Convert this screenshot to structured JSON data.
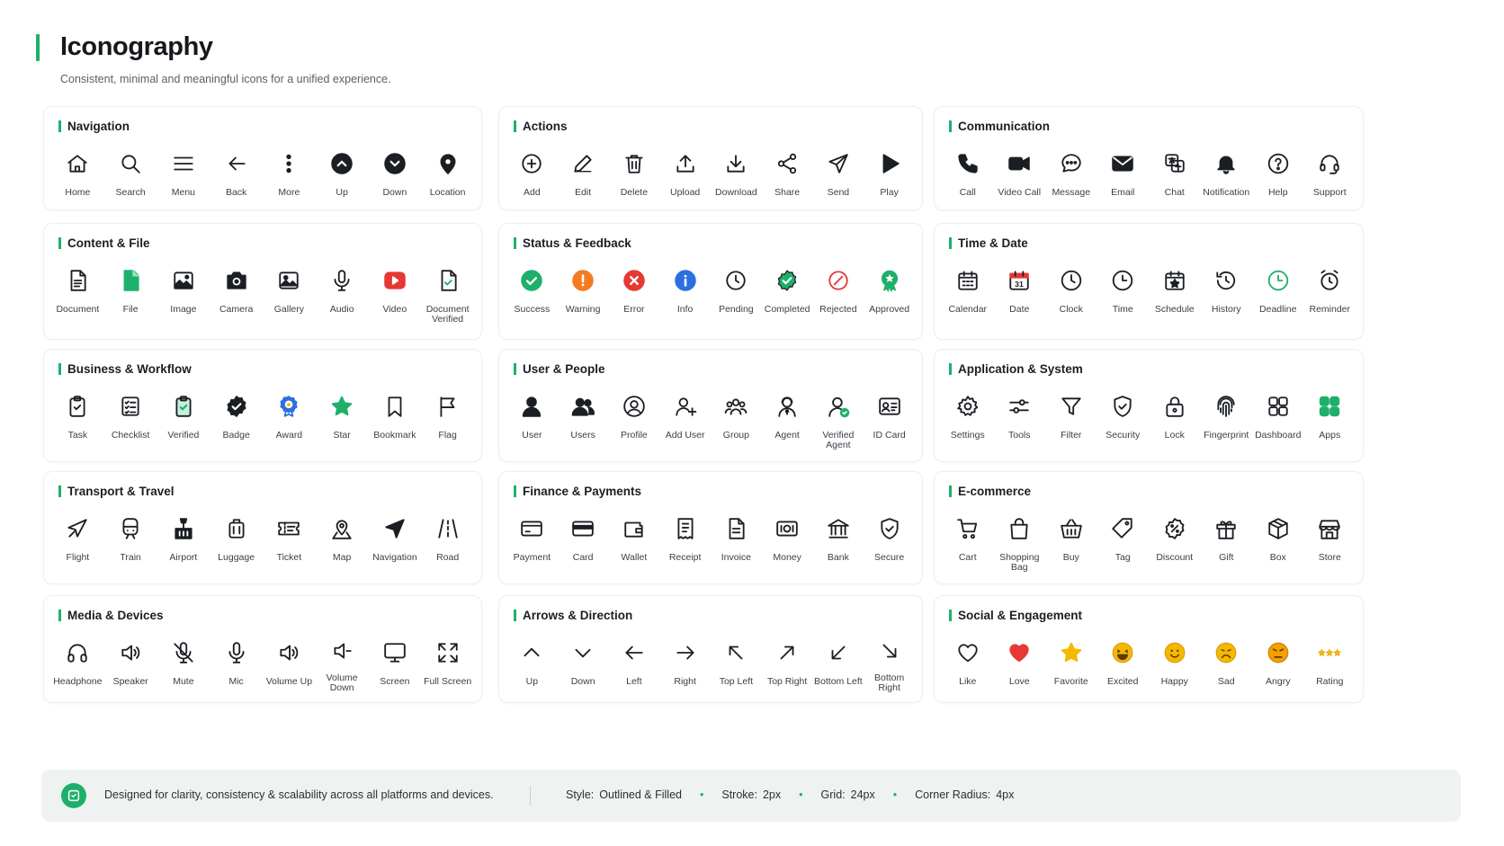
{
  "header": {
    "title": "Iconography",
    "subtitle": "Consistent, minimal and meaningful icons for a unified experience."
  },
  "colors": {
    "accent": "#1eb06a",
    "warning": "#f47b20",
    "error": "#e53935",
    "info": "#2d6fe0",
    "text": "#1b1f24"
  },
  "sections": [
    {
      "title": "Navigation",
      "items": [
        {
          "label": "Home",
          "icon": "home-icon"
        },
        {
          "label": "Search",
          "icon": "search-icon"
        },
        {
          "label": "Menu",
          "icon": "menu-icon"
        },
        {
          "label": "Back",
          "icon": "back-arrow-icon"
        },
        {
          "label": "More",
          "icon": "more-vertical-icon"
        },
        {
          "label": "Up",
          "icon": "chevron-up-circle-icon"
        },
        {
          "label": "Down",
          "icon": "chevron-down-circle-icon"
        },
        {
          "label": "Location",
          "icon": "location-pin-icon"
        }
      ]
    },
    {
      "title": "Actions",
      "items": [
        {
          "label": "Add",
          "icon": "add-circle-icon"
        },
        {
          "label": "Edit",
          "icon": "pencil-icon"
        },
        {
          "label": "Delete",
          "icon": "trash-icon"
        },
        {
          "label": "Upload",
          "icon": "upload-icon"
        },
        {
          "label": "Download",
          "icon": "download-icon"
        },
        {
          "label": "Share",
          "icon": "share-icon"
        },
        {
          "label": "Send",
          "icon": "send-icon"
        },
        {
          "label": "Play",
          "icon": "play-icon"
        }
      ]
    },
    {
      "title": "Communication",
      "items": [
        {
          "label": "Call",
          "icon": "phone-icon"
        },
        {
          "label": "Video Call",
          "icon": "video-camera-icon"
        },
        {
          "label": "Message",
          "icon": "chat-bubble-icon"
        },
        {
          "label": "Email",
          "icon": "envelope-icon"
        },
        {
          "label": "Chat",
          "icon": "translate-chat-icon"
        },
        {
          "label": "Notification",
          "icon": "bell-icon"
        },
        {
          "label": "Help",
          "icon": "help-circle-icon"
        },
        {
          "label": "Support",
          "icon": "headset-icon"
        }
      ]
    },
    {
      "title": "Content & File",
      "items": [
        {
          "label": "Document",
          "icon": "document-icon"
        },
        {
          "label": "File",
          "icon": "file-filled-icon"
        },
        {
          "label": "Image",
          "icon": "image-icon"
        },
        {
          "label": "Camera",
          "icon": "camera-icon"
        },
        {
          "label": "Gallery",
          "icon": "gallery-icon"
        },
        {
          "label": "Audio",
          "icon": "microphone-icon"
        },
        {
          "label": "Video",
          "icon": "video-play-icon"
        },
        {
          "label": "Document Verified",
          "icon": "document-check-icon"
        }
      ]
    },
    {
      "title": "Status & Feedback",
      "items": [
        {
          "label": "Success",
          "icon": "success-circle-icon"
        },
        {
          "label": "Warning",
          "icon": "warning-circle-icon"
        },
        {
          "label": "Error",
          "icon": "error-circle-icon"
        },
        {
          "label": "Info",
          "icon": "info-circle-icon"
        },
        {
          "label": "Pending",
          "icon": "clock-pending-icon"
        },
        {
          "label": "Completed",
          "icon": "completed-badge-icon"
        },
        {
          "label": "Rejected",
          "icon": "rejected-icon"
        },
        {
          "label": "Approved",
          "icon": "approved-award-icon"
        }
      ]
    },
    {
      "title": "Time & Date",
      "items": [
        {
          "label": "Calendar",
          "icon": "calendar-icon"
        },
        {
          "label": "Date",
          "icon": "date-31-icon"
        },
        {
          "label": "Clock",
          "icon": "clock-icon"
        },
        {
          "label": "Time",
          "icon": "time-icon"
        },
        {
          "label": "Schedule",
          "icon": "schedule-icon"
        },
        {
          "label": "History",
          "icon": "history-icon"
        },
        {
          "label": "Deadline",
          "icon": "deadline-icon"
        },
        {
          "label": "Reminder",
          "icon": "alarm-icon"
        }
      ]
    },
    {
      "title": "Business & Workflow",
      "items": [
        {
          "label": "Task",
          "icon": "clipboard-icon"
        },
        {
          "label": "Checklist",
          "icon": "checklist-icon"
        },
        {
          "label": "Verified",
          "icon": "verified-clipboard-icon"
        },
        {
          "label": "Badge",
          "icon": "badge-check-icon"
        },
        {
          "label": "Award",
          "icon": "award-icon"
        },
        {
          "label": "Star",
          "icon": "star-filled-icon"
        },
        {
          "label": "Bookmark",
          "icon": "bookmark-icon"
        },
        {
          "label": "Flag",
          "icon": "flag-icon"
        }
      ]
    },
    {
      "title": "User & People",
      "items": [
        {
          "label": "User",
          "icon": "user-icon"
        },
        {
          "label": "Users",
          "icon": "users-icon"
        },
        {
          "label": "Profile",
          "icon": "profile-circle-icon"
        },
        {
          "label": "Add User",
          "icon": "add-user-icon"
        },
        {
          "label": "Group",
          "icon": "group-icon"
        },
        {
          "label": "Agent",
          "icon": "agent-icon"
        },
        {
          "label": "Verified Agent",
          "icon": "verified-agent-icon"
        },
        {
          "label": "ID Card",
          "icon": "id-card-icon"
        }
      ]
    },
    {
      "title": "Application & System",
      "items": [
        {
          "label": "Settings",
          "icon": "gear-icon"
        },
        {
          "label": "Tools",
          "icon": "sliders-icon"
        },
        {
          "label": "Filter",
          "icon": "filter-icon"
        },
        {
          "label": "Security",
          "icon": "shield-check-icon"
        },
        {
          "label": "Lock",
          "icon": "lock-icon"
        },
        {
          "label": "Fingerprint",
          "icon": "fingerprint-icon"
        },
        {
          "label": "Dashboard",
          "icon": "dashboard-icon"
        },
        {
          "label": "Apps",
          "icon": "apps-grid-icon"
        }
      ]
    },
    {
      "title": "Transport & Travel",
      "items": [
        {
          "label": "Flight",
          "icon": "airplane-icon"
        },
        {
          "label": "Train",
          "icon": "train-icon"
        },
        {
          "label": "Airport",
          "icon": "airport-icon"
        },
        {
          "label": "Luggage",
          "icon": "luggage-icon"
        },
        {
          "label": "Ticket",
          "icon": "ticket-icon"
        },
        {
          "label": "Map",
          "icon": "map-pin-icon"
        },
        {
          "label": "Navigation",
          "icon": "navigation-arrow-icon"
        },
        {
          "label": "Road",
          "icon": "road-icon"
        }
      ]
    },
    {
      "title": "Finance & Payments",
      "items": [
        {
          "label": "Payment",
          "icon": "payment-icon"
        },
        {
          "label": "Card",
          "icon": "credit-card-icon"
        },
        {
          "label": "Wallet",
          "icon": "wallet-icon"
        },
        {
          "label": "Receipt",
          "icon": "receipt-icon"
        },
        {
          "label": "Invoice",
          "icon": "invoice-icon"
        },
        {
          "label": "Money",
          "icon": "money-icon"
        },
        {
          "label": "Bank",
          "icon": "bank-icon"
        },
        {
          "label": "Secure",
          "icon": "secure-shield-icon"
        }
      ]
    },
    {
      "title": "E-commerce",
      "items": [
        {
          "label": "Cart",
          "icon": "cart-icon"
        },
        {
          "label": "Shopping Bag",
          "icon": "shopping-bag-icon"
        },
        {
          "label": "Buy",
          "icon": "basket-icon"
        },
        {
          "label": "Tag",
          "icon": "tag-icon"
        },
        {
          "label": "Discount",
          "icon": "discount-icon"
        },
        {
          "label": "Gift",
          "icon": "gift-icon"
        },
        {
          "label": "Box",
          "icon": "box-icon"
        },
        {
          "label": "Store",
          "icon": "store-icon"
        }
      ]
    },
    {
      "title": "Media & Devices",
      "items": [
        {
          "label": "Headphone",
          "icon": "headphone-icon"
        },
        {
          "label": "Speaker",
          "icon": "speaker-icon"
        },
        {
          "label": "Mute",
          "icon": "mute-mic-icon"
        },
        {
          "label": "Mic",
          "icon": "mic-icon"
        },
        {
          "label": "Volume Up",
          "icon": "volume-up-icon"
        },
        {
          "label": "Volume Down",
          "icon": "volume-down-icon"
        },
        {
          "label": "Screen",
          "icon": "monitor-icon"
        },
        {
          "label": "Full Screen",
          "icon": "fullscreen-icon"
        }
      ]
    },
    {
      "title": "Arrows & Direction",
      "items": [
        {
          "label": "Up",
          "icon": "chevron-up-icon"
        },
        {
          "label": "Down",
          "icon": "chevron-down-icon"
        },
        {
          "label": "Left",
          "icon": "arrow-left-icon"
        },
        {
          "label": "Right",
          "icon": "arrow-right-icon"
        },
        {
          "label": "Top Left",
          "icon": "arrow-top-left-icon"
        },
        {
          "label": "Top Right",
          "icon": "arrow-top-right-icon"
        },
        {
          "label": "Bottom Left",
          "icon": "arrow-bottom-left-icon"
        },
        {
          "label": "Bottom Right",
          "icon": "arrow-bottom-right-icon"
        }
      ]
    },
    {
      "title": "Social & Engagement",
      "items": [
        {
          "label": "Like",
          "icon": "heart-outline-icon"
        },
        {
          "label": "Love",
          "icon": "heart-filled-icon"
        },
        {
          "label": "Favorite",
          "icon": "star-gold-icon"
        },
        {
          "label": "Excited",
          "icon": "excited-face-icon"
        },
        {
          "label": "Happy",
          "icon": "happy-face-icon"
        },
        {
          "label": "Sad",
          "icon": "sad-face-icon"
        },
        {
          "label": "Angry",
          "icon": "angry-face-icon"
        },
        {
          "label": "Rating",
          "icon": "three-stars-icon"
        }
      ]
    }
  ],
  "footer": {
    "text": "Designed for clarity, consistency & scalability across all platforms and devices.",
    "specs": [
      {
        "key": "Style:",
        "value": "Outlined & Filled"
      },
      {
        "key": "Stroke:",
        "value": "2px"
      },
      {
        "key": "Grid:",
        "value": "24px"
      },
      {
        "key": "Corner Radius:",
        "value": "4px"
      }
    ]
  }
}
